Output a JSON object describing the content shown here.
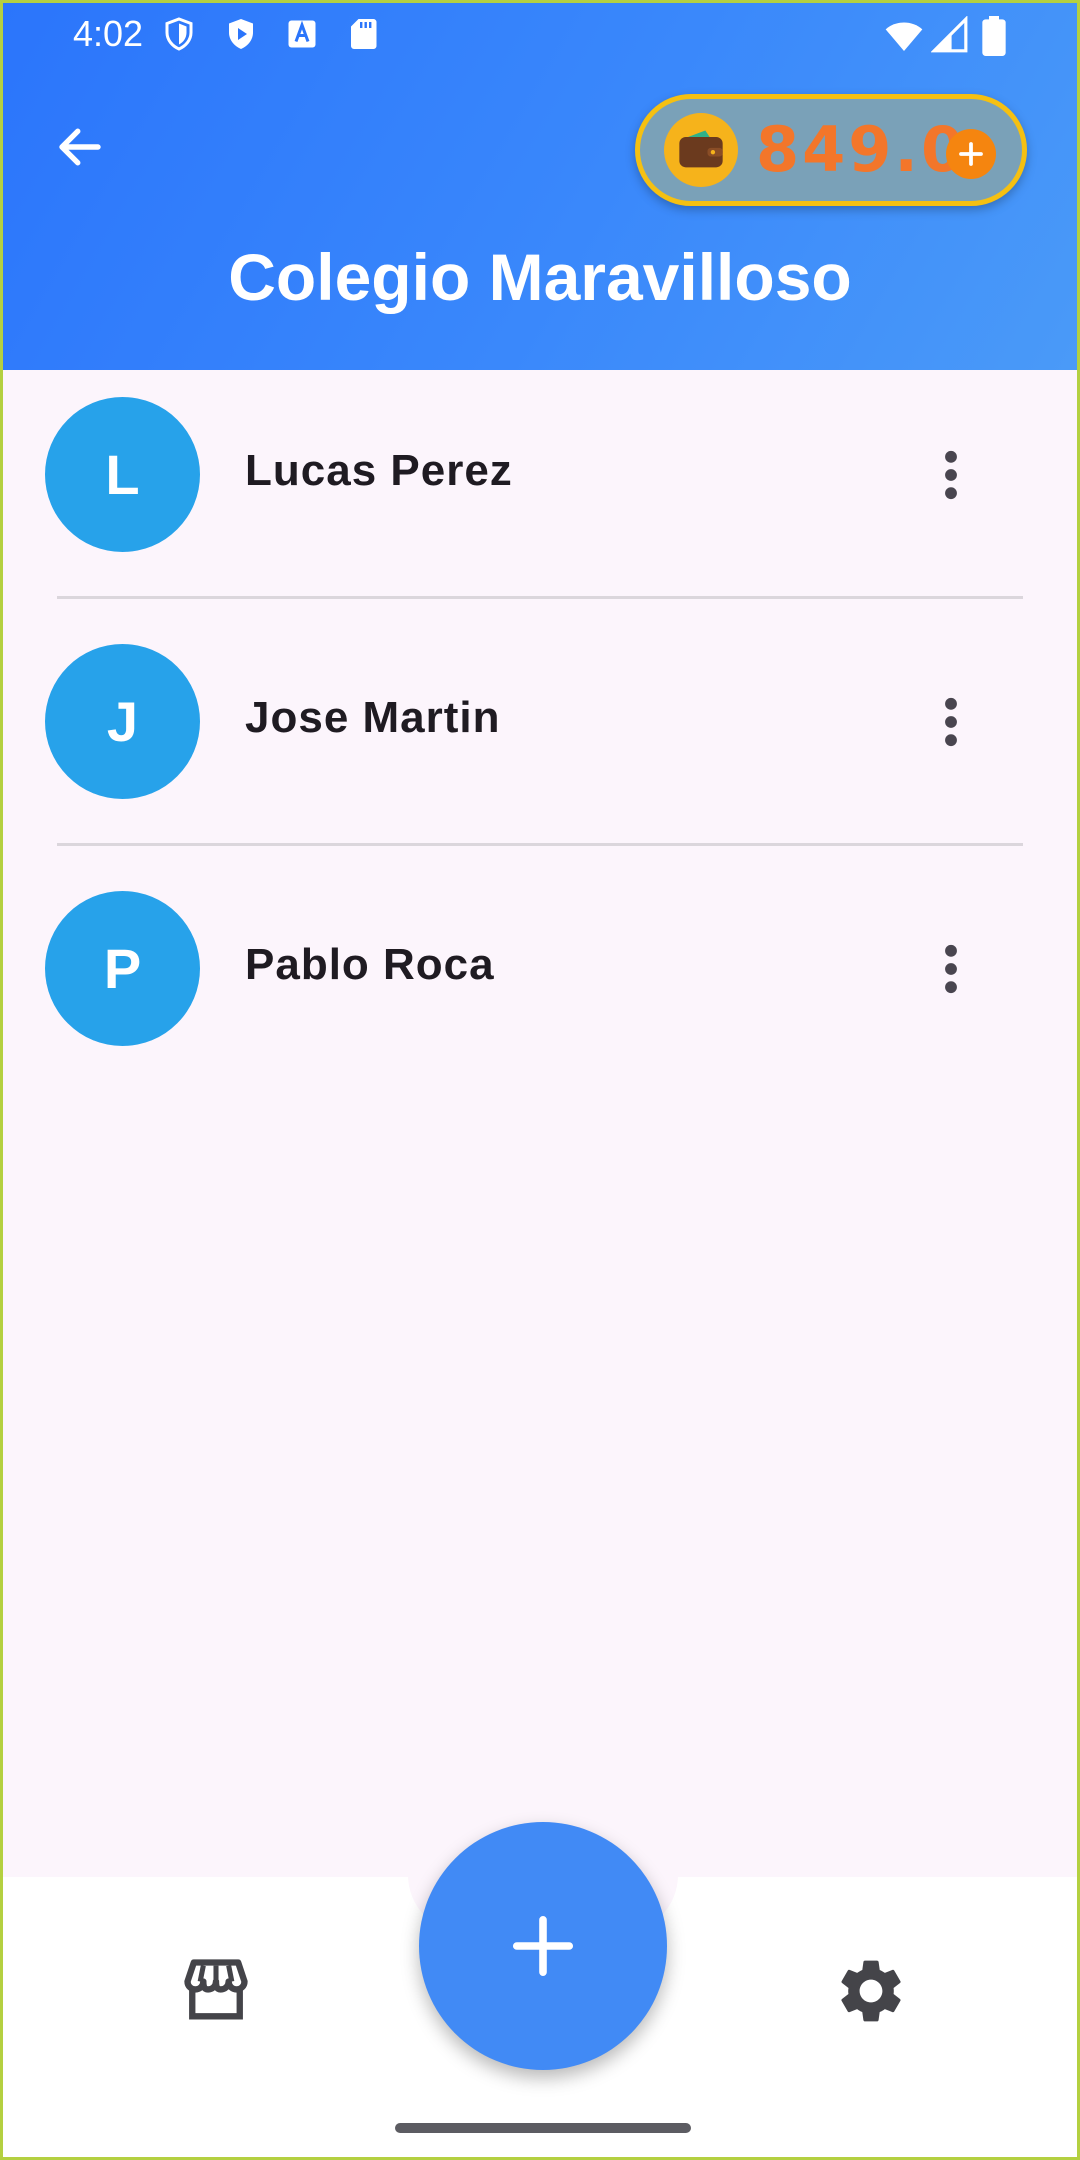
{
  "status_bar": {
    "time": "4:02",
    "left_icons": [
      "shield-outline-icon",
      "play-shield-icon",
      "keyboard-a-icon",
      "sd-card-icon"
    ],
    "right_icons": [
      "wifi-icon",
      "cellular-signal-icon",
      "battery-icon"
    ]
  },
  "header": {
    "back_icon": "arrow-back-icon",
    "title": "Colegio Maravilloso",
    "colors": {
      "gradient_start": "#2b75fb",
      "gradient_end": "#4a9af8"
    }
  },
  "wallet": {
    "icon": "wallet-icon",
    "amount": "849.0",
    "add_icon": "plus-circle-icon",
    "colors": {
      "amount": "#f3762a",
      "border": "#f5c012"
    }
  },
  "students": [
    {
      "initial": "L",
      "name": "Lucas Perez"
    },
    {
      "initial": "J",
      "name": "Jose Martin"
    },
    {
      "initial": "P",
      "name": "Pablo Roca"
    }
  ],
  "row_menu_icon": "more-vert-icon",
  "avatar_color": "#27a2ea",
  "bottom_nav": {
    "left_icon": "store-icon",
    "fab_icon": "plus-icon",
    "right_icon": "gear-icon",
    "fab_color": "#418af5"
  }
}
